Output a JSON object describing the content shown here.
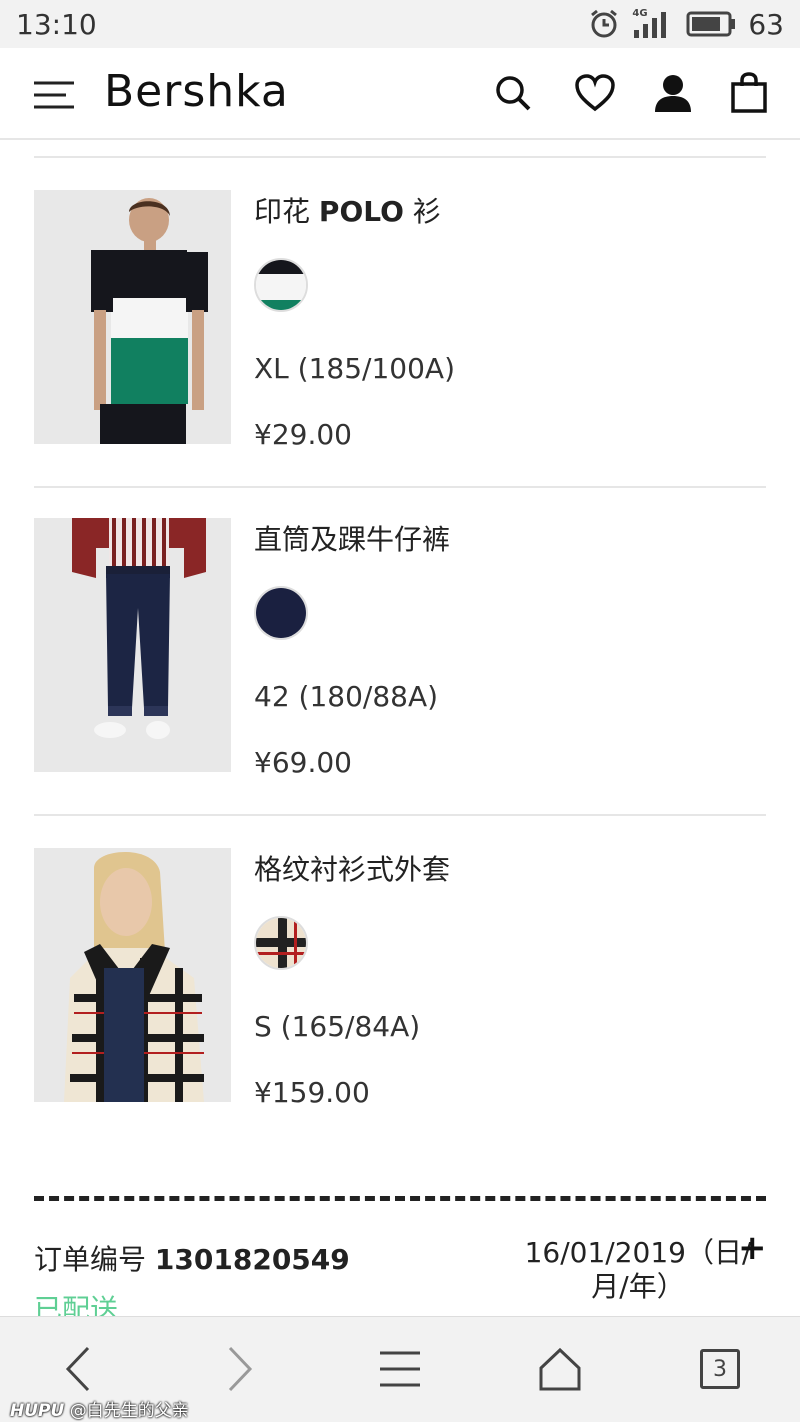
{
  "status_bar": {
    "time": "13:10",
    "network": "4G",
    "battery": "63",
    "icons": [
      "alarm-icon",
      "signal-icon",
      "battery-icon"
    ]
  },
  "header": {
    "logo": "Bershka",
    "icons": [
      "menu-icon",
      "search-icon",
      "heart-icon",
      "user-icon",
      "bag-icon"
    ]
  },
  "products": [
    {
      "name_prefix": "印花",
      "name_bold": "POLO",
      "name_suffix": "衫",
      "size": "XL (185/100A)",
      "price": "¥29.00",
      "swatch": "black/white/green stripes"
    },
    {
      "name": "直筒及踝牛仔裤",
      "size": "42 (180/88A)",
      "price": "¥69.00",
      "swatch": "navy denim"
    },
    {
      "name": "格纹衬衫式外套",
      "size": "S (165/84A)",
      "price": "¥159.00",
      "swatch": "cream/black/red check"
    }
  ],
  "order": {
    "label": "订单编号",
    "number": "1301820549",
    "date": "16/01/2019（日/月/年）",
    "expand_icon": "+",
    "status": "已配送"
  },
  "bottom_nav": {
    "tabs_count": "3",
    "icons": [
      "back-icon",
      "forward-icon",
      "menu-icon",
      "home-icon",
      "tabs-icon"
    ]
  },
  "watermark": {
    "brand": "HUPU",
    "text": "@白先生的父亲"
  },
  "colors": {
    "status_delivered": "#5fcf94",
    "bar_bg": "#f2f2f2"
  }
}
